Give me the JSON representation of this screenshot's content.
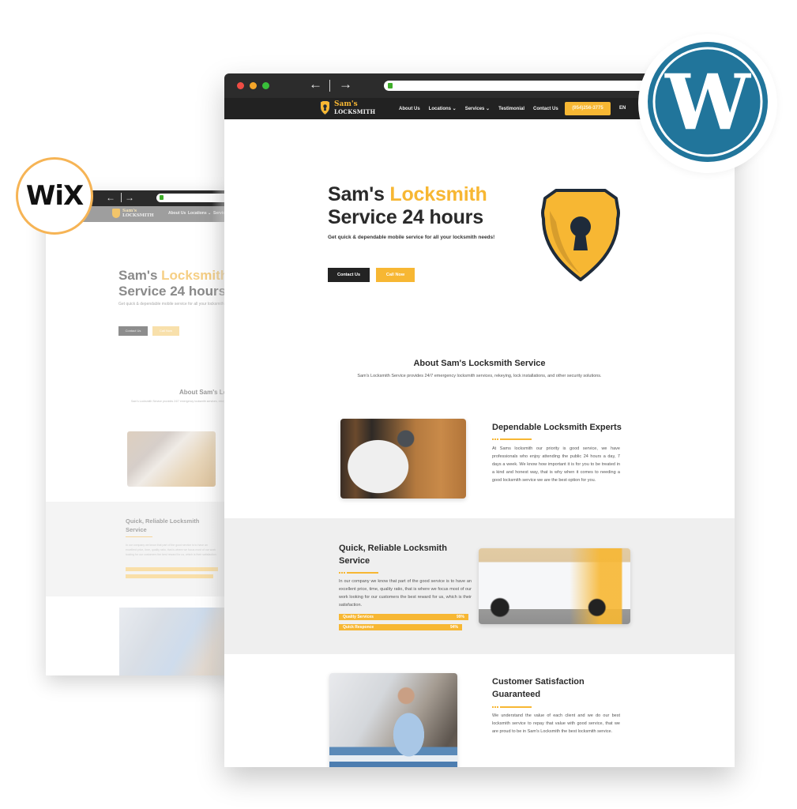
{
  "badges": {
    "wix": {
      "label": "WiX",
      "ring_color": "#f6b455"
    },
    "wordpress": {
      "label": "WordPress",
      "color": "#21759b"
    }
  },
  "colors": {
    "accent": "#f7b733",
    "nav_bg": "#222222",
    "chrome_bg": "#2c2c2c",
    "band_bg": "#efefef"
  },
  "browser": {
    "back_icon": "arrow-left-icon",
    "forward_icon": "arrow-right-icon",
    "back_glyph": "←",
    "forward_glyph": "→",
    "url": ""
  },
  "site": {
    "logo": {
      "line1": "Sam's",
      "line2": "LOCKSMITH"
    },
    "nav": {
      "items": [
        {
          "label": "About Us"
        },
        {
          "label": "Locations ⌄"
        },
        {
          "label": "Services ⌄"
        },
        {
          "label": "Testimonial"
        },
        {
          "label": "Contact Us"
        }
      ],
      "phone": "(954)256-3775",
      "lang": "EN"
    },
    "hero": {
      "title_part1": "Sam's ",
      "title_accent": "Locksmith",
      "title_line2": "Service 24 hours",
      "subtitle": "Get quick & dependable mobile service for all your locksmith needs!",
      "primary_button": "Contact Us",
      "secondary_button": "Call Now"
    },
    "about": {
      "title": "About Sam's Locksmith Service",
      "subtitle": "Sam's Locksmith Service provides 24/7 emergency locksmith services, rekeying, lock installations, and other security solutions."
    },
    "sections": [
      {
        "title": "Dependable Locksmith Experts",
        "body": "At Sams locksmith our priority is good service, we have professionals who enjoy attending the public 24 hours a day, 7 days a week. We know how important it is for you to be treated in a kind and honest way, that is why when it comes to needing a good locksmith service we are the best option for you."
      },
      {
        "title": "Quick, Reliable Locksmith Service",
        "body": "In our company we know that part of the good service is to have an excellent price, time, quality ratio, that is where we focus most of our work looking for our customers the best reward for us, which is their satisfaction.",
        "skills": [
          {
            "label": "Quality Services",
            "value_text": "99%",
            "percent": 99
          },
          {
            "label": "Quick Responce",
            "value_text": "94%",
            "percent": 94
          }
        ]
      },
      {
        "title": "Customer Satisfaction Guaranteed",
        "body": "We understand the value of each client and we do our best locksmith service to repay that value with good service, that we are proud to be in Sam's Locksmith the best locksmith service."
      }
    ]
  }
}
